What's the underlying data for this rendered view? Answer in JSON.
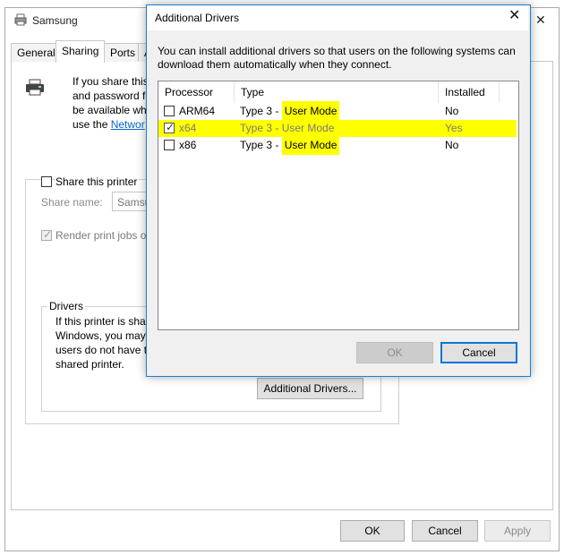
{
  "back_window": {
    "title": "Samsung",
    "tabs": [
      {
        "label": "General"
      },
      {
        "label": "Sharing"
      },
      {
        "label": "Ports"
      },
      {
        "label": "A"
      }
    ],
    "intro_lines": [
      "If you share this",
      "and password fo",
      "be available whe"
    ],
    "intro_prefix": "use the ",
    "intro_link": "Networ",
    "share_checkbox_label": "Share this printer",
    "share_name_label": "Share name:",
    "share_name_value": "Samsu",
    "render_label": "Render print jobs o",
    "drivers_legend": "Drivers",
    "drivers_lines": [
      "If this printer is shar",
      "Windows, you may",
      "users do not have t",
      "shared printer."
    ],
    "additional_drivers_button": "Additional Drivers...",
    "ok_button": "OK",
    "cancel_button": "Cancel",
    "apply_button": "Apply"
  },
  "dialog": {
    "title": "Additional Drivers",
    "description": "You can install additional drivers so that users on the following systems can download them automatically when they connect.",
    "columns": [
      "Processor",
      "Type",
      "Installed"
    ],
    "rows": [
      {
        "processor": "ARM64",
        "type_prefix": "Type 3 - ",
        "type_mode": "User Mode",
        "installed": "No",
        "checked": false
      },
      {
        "processor": "x64",
        "type_prefix": "Type 3 - ",
        "type_mode": "User Mode",
        "installed": "Yes",
        "checked": true
      },
      {
        "processor": "x86",
        "type_prefix": "Type 3 - ",
        "type_mode": "User Mode",
        "installed": "No",
        "checked": false
      }
    ],
    "ok_button": "OK",
    "cancel_button": "Cancel"
  },
  "colors": {
    "highlight": "#ffff00",
    "accent": "#0078d7",
    "link": "#0066cc"
  }
}
